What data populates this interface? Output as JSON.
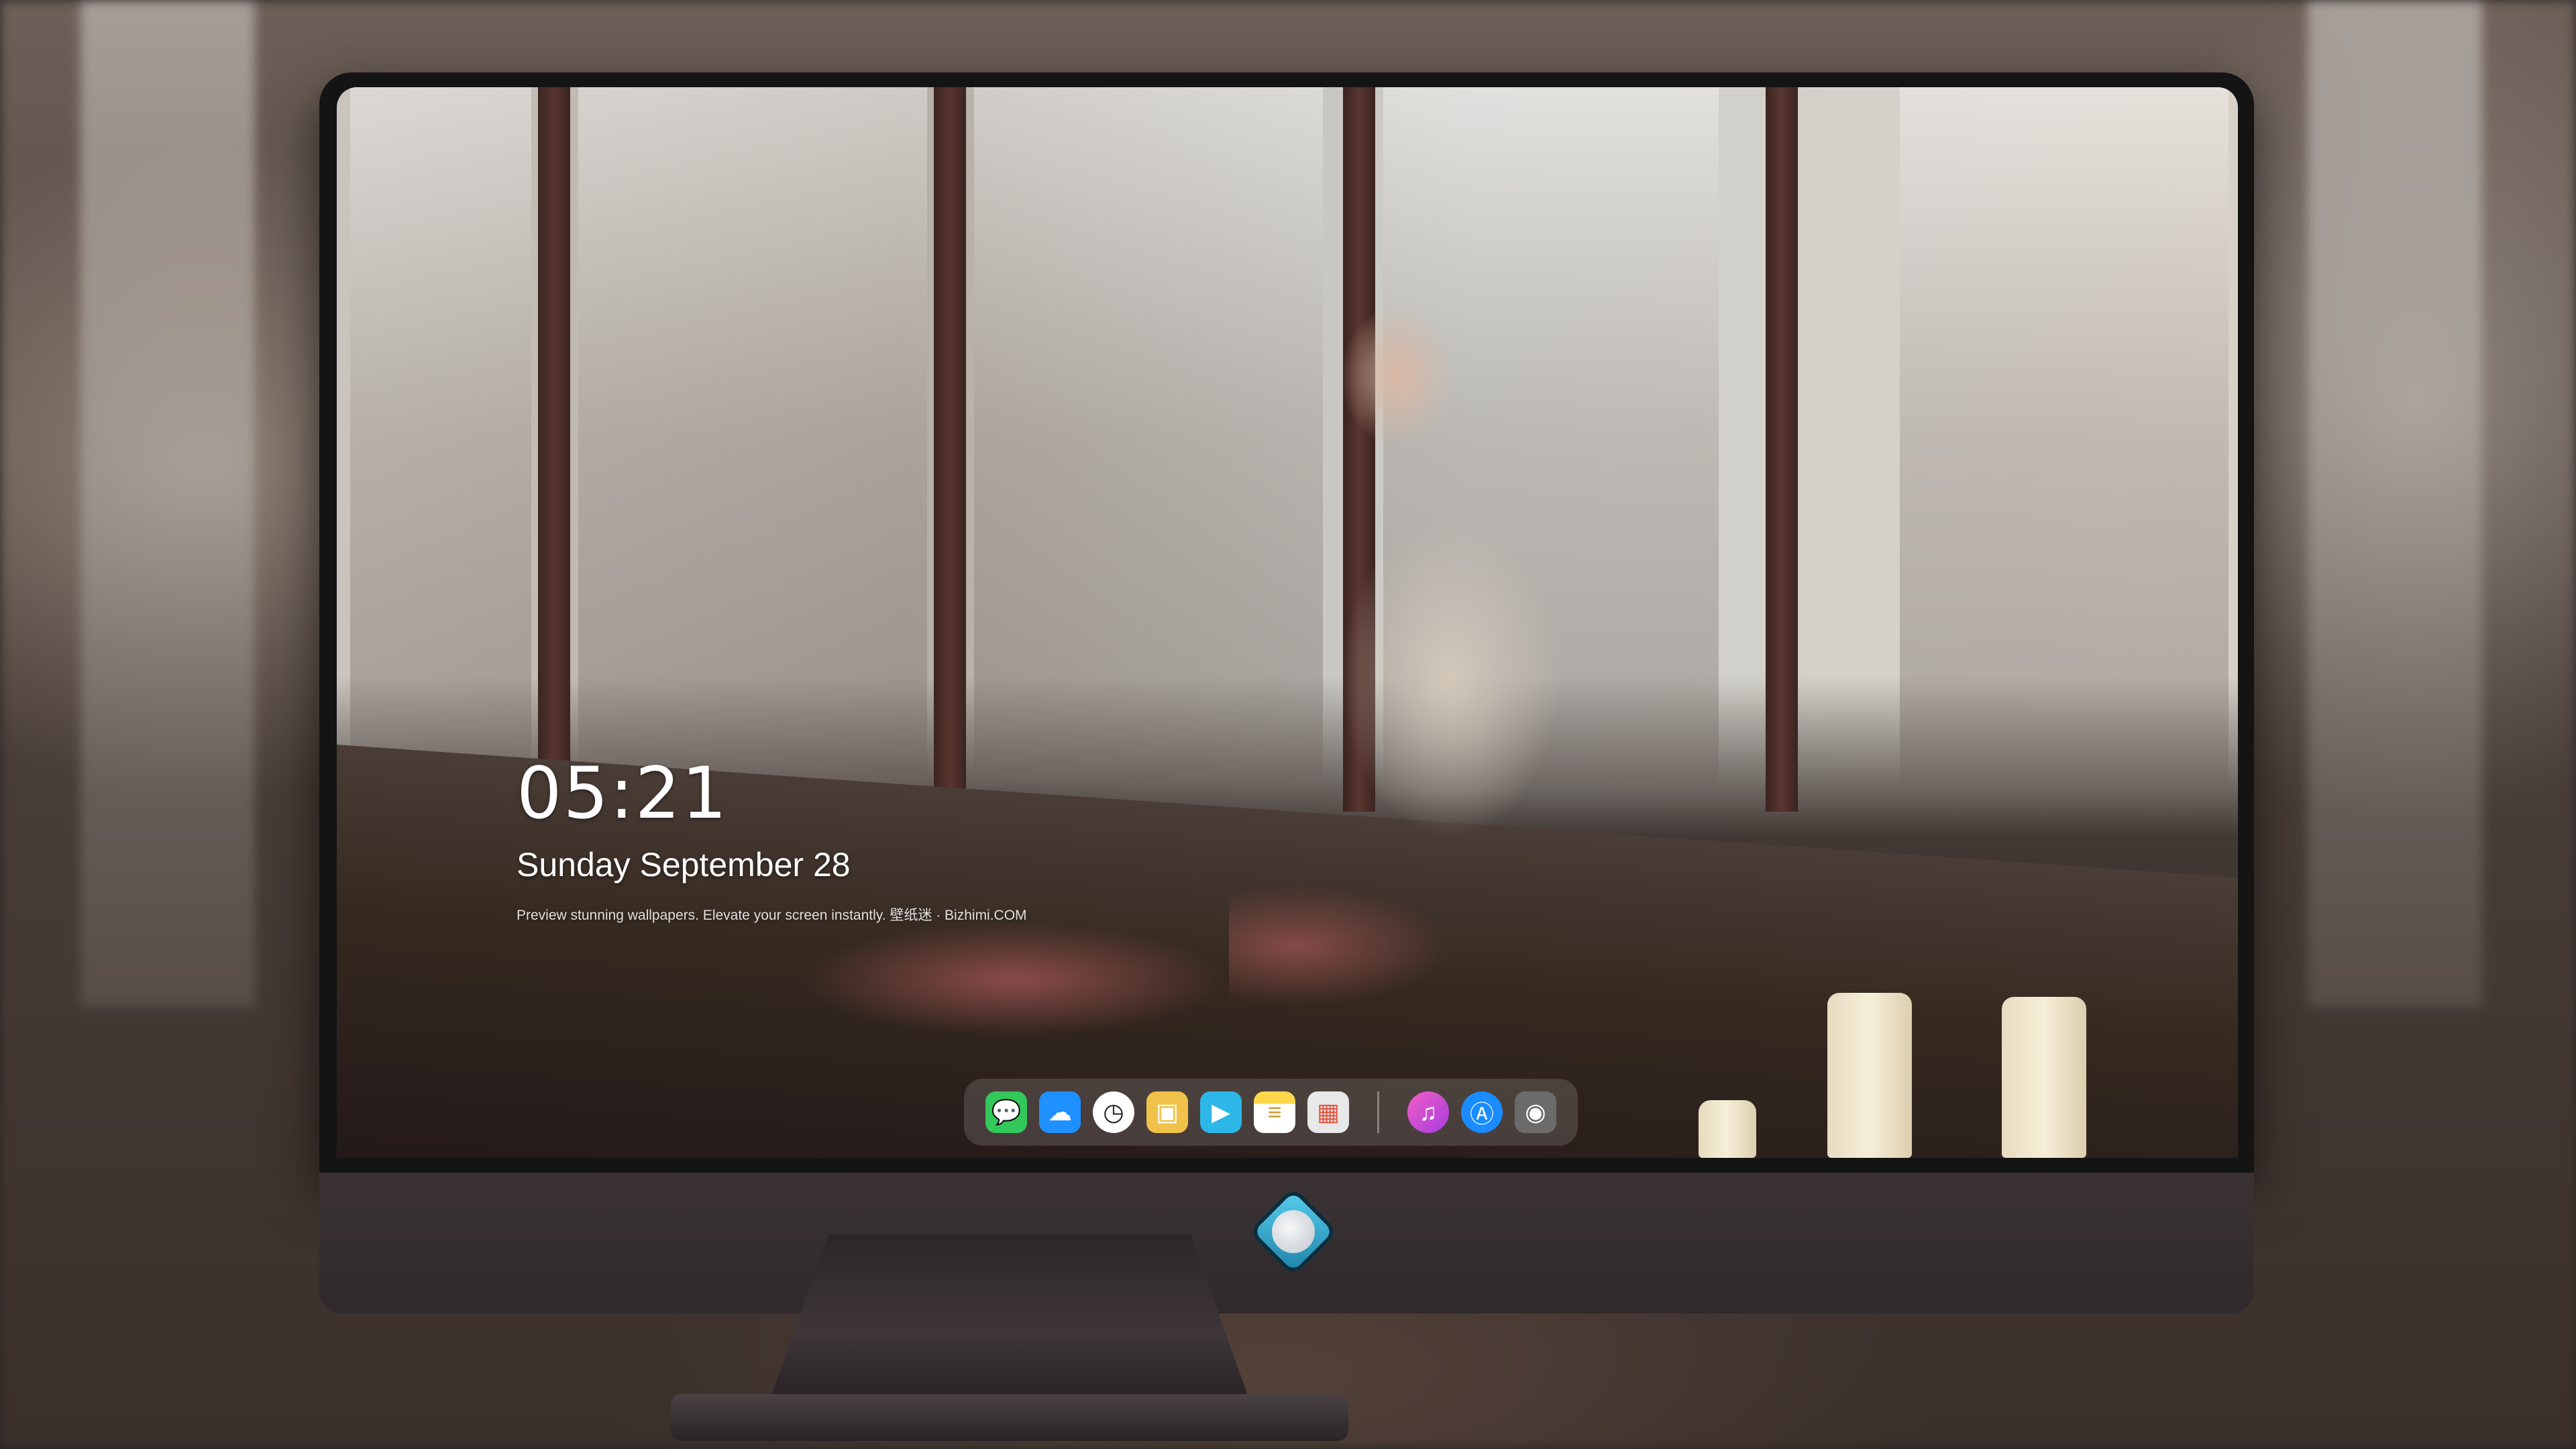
{
  "lock_screen": {
    "time": "05:21",
    "date": "Sunday September  28",
    "tagline": "Preview stunning wallpapers. Elevate your screen instantly. 壁纸迷 · Bizhimi.COM"
  },
  "dock": {
    "apps": [
      {
        "name": "Messages",
        "icon": "messages-icon",
        "color": "#34c759",
        "glyph": "💬"
      },
      {
        "name": "Weather",
        "icon": "weather-icon",
        "color": "#1e90ff",
        "glyph": "☁"
      },
      {
        "name": "Clock",
        "icon": "clock-icon",
        "color": "#ffffff",
        "glyph": "🕓"
      },
      {
        "name": "Preview",
        "icon": "preview-icon",
        "color": "#f0c24a",
        "glyph": "🖼"
      },
      {
        "name": "Clips",
        "icon": "clips-icon",
        "color": "#2db7e8",
        "glyph": "🎬"
      },
      {
        "name": "Notes",
        "icon": "notes-icon",
        "color": "#ffd84a",
        "glyph": "▤"
      },
      {
        "name": "Photos",
        "icon": "photos-icon",
        "color": "#e8e8e8",
        "glyph": "▦"
      },
      {
        "name": "iTunes",
        "icon": "music-icon",
        "color": "#d83bd2",
        "glyph": "♫"
      },
      {
        "name": "App Store",
        "icon": "app-store-icon",
        "color": "#1a8cff",
        "glyph": "Ⓐ"
      },
      {
        "name": "Camera",
        "icon": "camera-icon",
        "color": "#5a5a5a",
        "glyph": "◉"
      }
    ]
  }
}
